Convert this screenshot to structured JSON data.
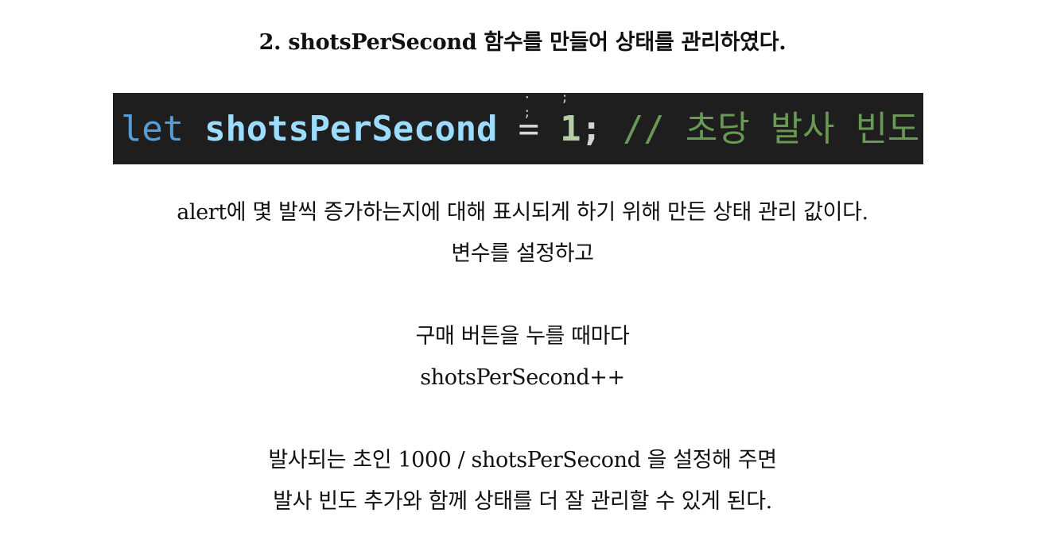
{
  "heading": "2. shotsPerSecond 함수를 만들어 상태를 관리하였다.",
  "code": {
    "top_artifact": "· ; ;",
    "keyword": "let ",
    "variable": "shotsPerSecond",
    "operator": " = ",
    "number": "1",
    "semicolon": ";",
    "comment": " // 초당 발사 빈도"
  },
  "paragraphs": [
    {
      "lines": [
        "alert에 몇 발씩 증가하는지에 대해 표시되게 하기 위해 만든 상태 관리 값이다.",
        "변수를 설정하고"
      ]
    },
    {
      "lines": [
        "구매 버튼을 누를 때마다",
        "shotsPerSecond++"
      ]
    },
    {
      "lines": [
        "발사되는 초인 1000 / shotsPerSecond 을 설정해 주면",
        "발사 빈도 추가와 함께 상태를 더 잘 관리할 수 있게 된다."
      ]
    }
  ],
  "colors": {
    "code_background": "#1e1e1e",
    "keyword": "#569cd6",
    "variable": "#9cdcfe",
    "number": "#b5cea8",
    "comment": "#6a9955"
  }
}
